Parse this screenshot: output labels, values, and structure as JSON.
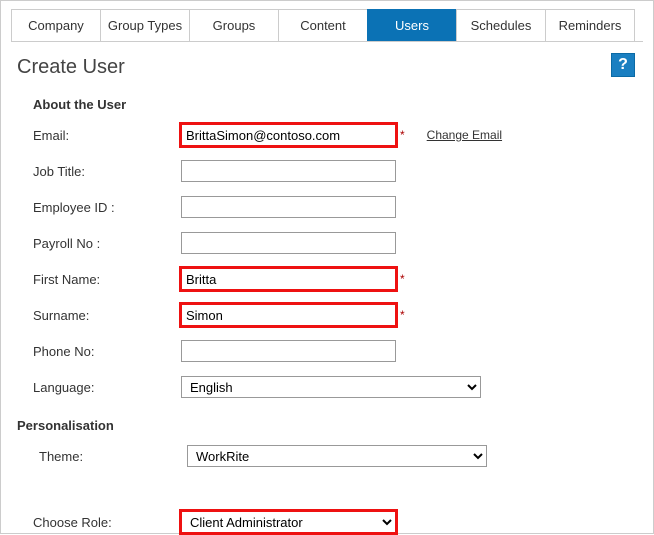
{
  "tabs": {
    "company": "Company",
    "group_types": "Group Types",
    "groups": "Groups",
    "content": "Content",
    "users": "Users",
    "schedules": "Schedules",
    "reminders": "Reminders"
  },
  "page_title": "Create User",
  "help_glyph": "?",
  "sections": {
    "about": "About the User",
    "personalisation": "Personalisation"
  },
  "labels": {
    "email": "Email:",
    "job_title": "Job Title:",
    "employee_id": "Employee ID :",
    "payroll_no": "Payroll No :",
    "first_name": "First Name:",
    "surname": "Surname:",
    "phone_no": "Phone No:",
    "language": "Language:",
    "theme": "Theme:",
    "choose_role": "Choose Role:"
  },
  "values": {
    "email": "BrittaSimon@contoso.com",
    "job_title": "",
    "employee_id": "",
    "payroll_no": "",
    "first_name": "Britta",
    "surname": "Simon",
    "phone_no": "",
    "language": "English",
    "theme": "WorkRite",
    "choose_role": "Client Administrator"
  },
  "links": {
    "change_email": "Change Email"
  },
  "required_marker": "*"
}
